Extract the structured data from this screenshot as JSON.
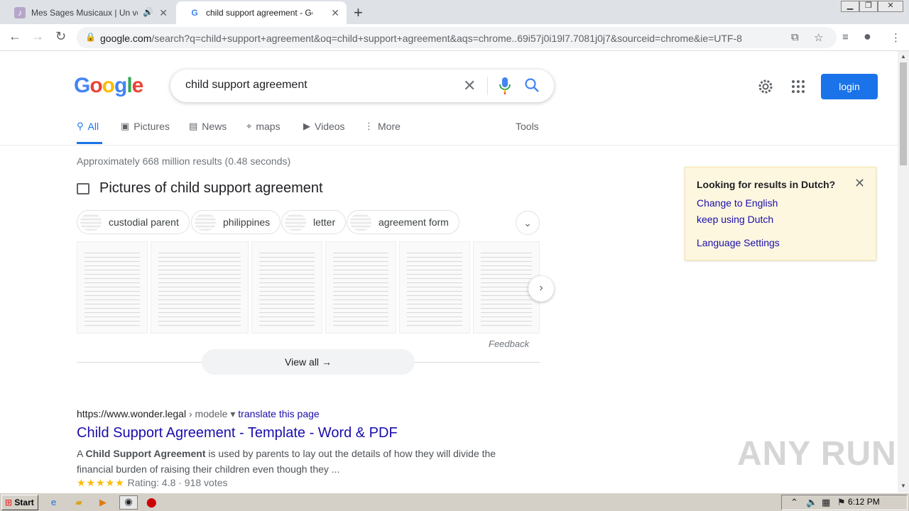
{
  "browser": {
    "tabs": [
      {
        "title": "Mes Sages Musicaux | Un voyage",
        "active": false,
        "audio": true
      },
      {
        "title": "child support agreement - Google Se",
        "active": true
      }
    ],
    "url": {
      "domain": "google.com",
      "path": "/search?q=child+support+agreement&oq=child+support+agreement&aqs=chrome..69i57j0i19l7.7081j0j7&sourceid=chrome&ie=UTF-8"
    }
  },
  "search": {
    "query": "child support agreement",
    "login_label": "login",
    "tabs": [
      {
        "label": "All",
        "icon": "search-icon"
      },
      {
        "label": "Pictures",
        "icon": "image-icon"
      },
      {
        "label": "News",
        "icon": "news-icon"
      },
      {
        "label": "maps",
        "icon": "map-pin-icon"
      },
      {
        "label": "Videos",
        "icon": "video-icon"
      },
      {
        "label": "More",
        "icon": "more-vert-icon"
      }
    ],
    "tools_label": "Tools",
    "stats": "Approximately 668 million results (0.48 seconds)"
  },
  "images": {
    "header": "Pictures of child support agreement",
    "chips": [
      "custodial parent",
      "philippines",
      "letter",
      "agreement form"
    ],
    "feedback": "Feedback",
    "view_all": "View all"
  },
  "result": {
    "url": "https://www.wonder.legal",
    "crumb": "› modele",
    "translate": "translate this page",
    "title": "Child Support Agreement - Template - Word & PDF",
    "snippet_pre": "A ",
    "snippet_bold": "Child Support Agreement",
    "snippet_post": " is used by parents to lay out the details of how they will divide the financial burden of raising their children even though they ...",
    "stars": "★★★★★",
    "rating": "Rating: 4.8 · 918 votes"
  },
  "language_popup": {
    "heading": "Looking for results in Dutch?",
    "link1": "Change to English",
    "link2": "keep using Dutch",
    "link3": "Language Settings"
  },
  "taskbar": {
    "start": "Start",
    "clock": "6:12 PM"
  },
  "watermark": "ANY RUN",
  "colors": {
    "accent": "#1a73e8",
    "link": "#1a0dab",
    "popup_bg": "#fef7e0"
  }
}
